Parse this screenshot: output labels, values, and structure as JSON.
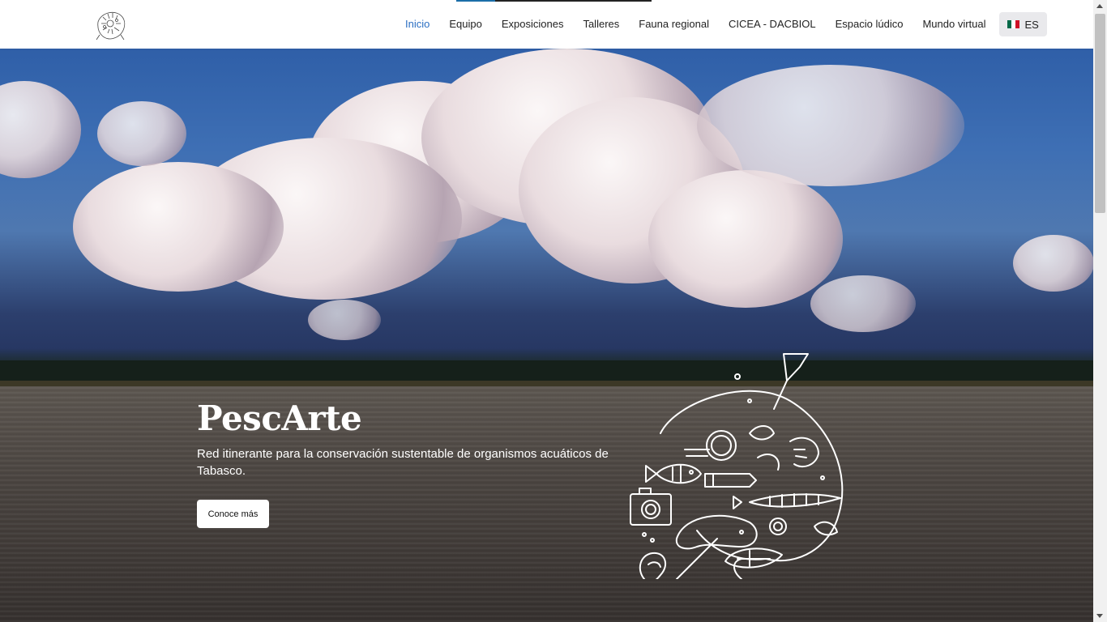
{
  "nav": {
    "logo_icon": "pescarte-logo-icon",
    "items": [
      {
        "label": "Inicio",
        "active": true
      },
      {
        "label": "Equipo"
      },
      {
        "label": "Exposiciones"
      },
      {
        "label": "Talleres"
      },
      {
        "label": "Fauna regional"
      },
      {
        "label": "CICEA - DACBIOL"
      },
      {
        "label": "Espacio lúdico"
      },
      {
        "label": "Mundo virtual"
      }
    ],
    "language": {
      "label": "ES",
      "flag_icon": "mexico-flag-icon"
    }
  },
  "hero": {
    "title": "PescArte",
    "subtitle": "Red itinerante para la conservación sustentable de organismos acuáticos de Tabasco.",
    "button_label": "Conoce más",
    "emblem_icon": "fish-fauna-brush-illustration-icon"
  },
  "colors": {
    "active_link": "#2a6ec2",
    "navbar_bg": "#ffffff",
    "lang_button_bg": "#e9e9ec",
    "hero_text": "#ffffff"
  }
}
